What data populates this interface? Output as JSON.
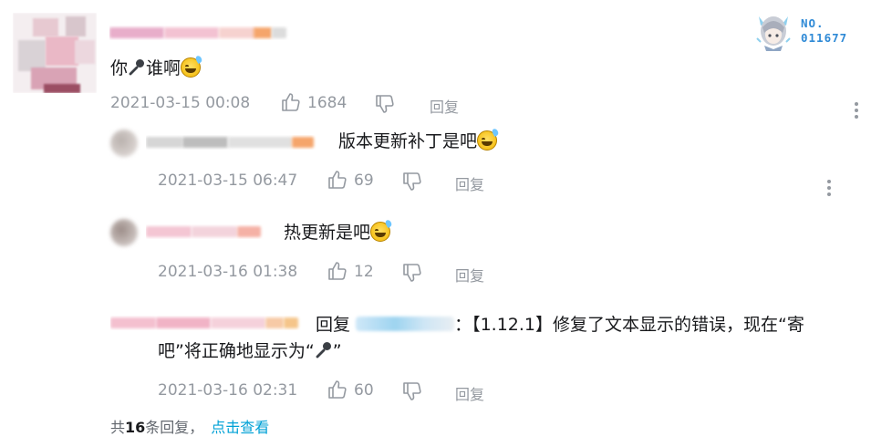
{
  "badge": {
    "label": "NO.",
    "number": "011677"
  },
  "main_comment": {
    "text": "你",
    "text_suffix": "谁啊",
    "date": "2021-03-15 00:08",
    "likes": "1684",
    "reply": "回复"
  },
  "replies": [
    {
      "text": "版本更新补丁是吧",
      "date": "2021-03-15 06:47",
      "likes": "69",
      "reply": "回复"
    },
    {
      "text": "热更新是吧",
      "date": "2021-03-16 01:38",
      "likes": "12",
      "reply": "回复"
    },
    {
      "reply_prefix": "回复",
      "text_line1": "：【1.12.1】修复了文本显示的错误，现在“寄",
      "text_line2_a": "吧”将正确地显示为“",
      "text_line2_b": "”",
      "date": "2021-03-16 02:31",
      "likes": "60",
      "reply": "回复"
    }
  ],
  "footer": {
    "prefix": "共",
    "count": "16",
    "suffix": "条回复，",
    "link": "点击查看"
  },
  "icons": [
    "like-icon",
    "dislike-icon",
    "more-icon",
    "microphone-icon",
    "sweat-smile-emoji"
  ],
  "colors": {
    "meta_gray": "#9499a0",
    "link_blue": "#00a1d6",
    "text": "#18191c",
    "badge_blue": "#2f8ad6"
  }
}
